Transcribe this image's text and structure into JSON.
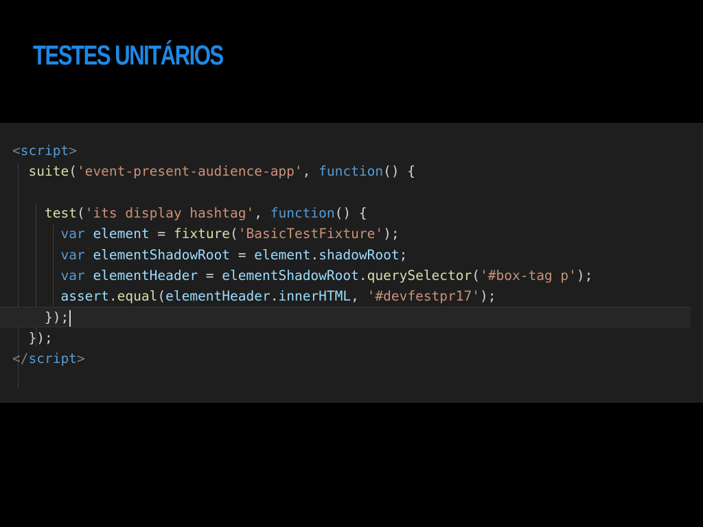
{
  "slide": {
    "title": "TESTES UNITÁRIOS"
  },
  "code": {
    "lines": [
      [
        {
          "t": "<",
          "c": "punc"
        },
        {
          "t": "script",
          "c": "tag"
        },
        {
          "t": ">",
          "c": "punc"
        }
      ],
      [
        {
          "t": "  ",
          "c": "txt"
        },
        {
          "t": "suite",
          "c": "fn"
        },
        {
          "t": "(",
          "c": "txt"
        },
        {
          "t": "'event-present-audience-app'",
          "c": "str"
        },
        {
          "t": ", ",
          "c": "txt"
        },
        {
          "t": "function",
          "c": "kw"
        },
        {
          "t": "() {",
          "c": "txt"
        }
      ],
      [],
      [
        {
          "t": "    ",
          "c": "txt"
        },
        {
          "t": "test",
          "c": "fn"
        },
        {
          "t": "(",
          "c": "txt"
        },
        {
          "t": "'its display hashtag'",
          "c": "str"
        },
        {
          "t": ", ",
          "c": "txt"
        },
        {
          "t": "function",
          "c": "kw"
        },
        {
          "t": "() {",
          "c": "txt"
        }
      ],
      [
        {
          "t": "      ",
          "c": "txt"
        },
        {
          "t": "var",
          "c": "kw"
        },
        {
          "t": " ",
          "c": "txt"
        },
        {
          "t": "element",
          "c": "var"
        },
        {
          "t": " = ",
          "c": "txt"
        },
        {
          "t": "fixture",
          "c": "fn"
        },
        {
          "t": "(",
          "c": "txt"
        },
        {
          "t": "'BasicTestFixture'",
          "c": "str"
        },
        {
          "t": ");",
          "c": "txt"
        }
      ],
      [
        {
          "t": "      ",
          "c": "txt"
        },
        {
          "t": "var",
          "c": "kw"
        },
        {
          "t": " ",
          "c": "txt"
        },
        {
          "t": "elementShadowRoot",
          "c": "var"
        },
        {
          "t": " = ",
          "c": "txt"
        },
        {
          "t": "element",
          "c": "var"
        },
        {
          "t": ".",
          "c": "txt"
        },
        {
          "t": "shadowRoot",
          "c": "var"
        },
        {
          "t": ";",
          "c": "txt"
        }
      ],
      [
        {
          "t": "      ",
          "c": "txt"
        },
        {
          "t": "var",
          "c": "kw"
        },
        {
          "t": " ",
          "c": "txt"
        },
        {
          "t": "elementHeader",
          "c": "var"
        },
        {
          "t": " = ",
          "c": "txt"
        },
        {
          "t": "elementShadowRoot",
          "c": "var"
        },
        {
          "t": ".",
          "c": "txt"
        },
        {
          "t": "querySelector",
          "c": "fn"
        },
        {
          "t": "(",
          "c": "txt"
        },
        {
          "t": "'#box-tag p'",
          "c": "str"
        },
        {
          "t": ");",
          "c": "txt"
        }
      ],
      [
        {
          "t": "      ",
          "c": "txt"
        },
        {
          "t": "assert",
          "c": "var"
        },
        {
          "t": ".",
          "c": "txt"
        },
        {
          "t": "equal",
          "c": "fn"
        },
        {
          "t": "(",
          "c": "txt"
        },
        {
          "t": "elementHeader",
          "c": "var"
        },
        {
          "t": ".",
          "c": "txt"
        },
        {
          "t": "innerHTML",
          "c": "var"
        },
        {
          "t": ", ",
          "c": "txt"
        },
        {
          "t": "'#devfestpr17'",
          "c": "str"
        },
        {
          "t": ");",
          "c": "txt"
        }
      ],
      [
        {
          "t": "    ",
          "c": "txt"
        },
        {
          "t": "});",
          "c": "txt"
        }
      ],
      [
        {
          "t": "  ",
          "c": "txt"
        },
        {
          "t": "});",
          "c": "txt"
        }
      ],
      [
        {
          "t": "</",
          "c": "punc"
        },
        {
          "t": "script",
          "c": "tag"
        },
        {
          "t": ">",
          "c": "punc"
        }
      ]
    ]
  },
  "editor": {
    "current_line_index": 8,
    "colors": {
      "background": "#1e1e1e",
      "tag": "#569cd6",
      "function": "#dcdcaa",
      "string": "#ce9178",
      "keyword": "#569cd6",
      "variable": "#9cdcfe",
      "title": "#1e88e5"
    }
  }
}
